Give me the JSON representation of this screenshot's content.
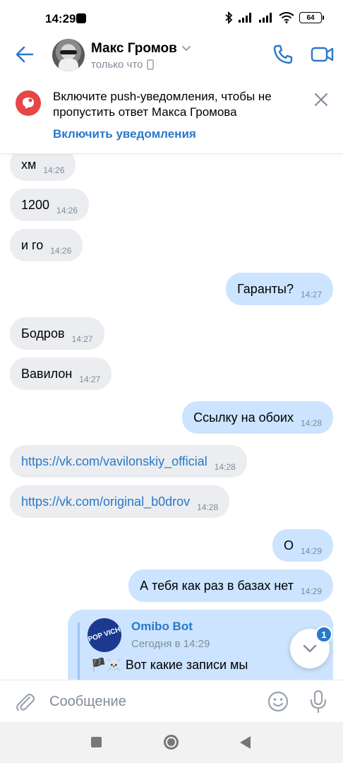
{
  "status_bar": {
    "time": "14:29",
    "battery": "64",
    "icons": [
      "notification-icon",
      "bluetooth-icon",
      "signal-icon",
      "signal-icon",
      "wifi-icon",
      "battery-icon"
    ]
  },
  "header": {
    "name": "Макс Громов",
    "status": "только что"
  },
  "banner": {
    "text": "Включите push-уведомления, чтобы не пропустить ответ Макса Громова",
    "link": "Включить уведомления"
  },
  "messages": [
    {
      "dir": "in",
      "text": "хм",
      "time": "14:26"
    },
    {
      "dir": "in",
      "text": "1200",
      "time": "14:26"
    },
    {
      "dir": "in",
      "text": "и го",
      "time": "14:26"
    },
    {
      "dir": "out",
      "text": "Гаранты?",
      "time": "14:27"
    },
    {
      "dir": "in",
      "text": "Бодров",
      "time": "14:27"
    },
    {
      "dir": "in",
      "text": "Вавилон",
      "time": "14:27"
    },
    {
      "dir": "out",
      "text": "Ссылку на обоих",
      "time": "14:28"
    },
    {
      "dir": "in",
      "text": "https://vk.com/vavilonskiy_official",
      "time": "14:28",
      "link": true
    },
    {
      "dir": "in",
      "text": "https://vk.com/original_b0drov",
      "time": "14:28",
      "link": true
    },
    {
      "dir": "out",
      "text": "О",
      "time": "14:29"
    },
    {
      "dir": "out",
      "text": "А тебя как раз в базах нет",
      "time": "14:29"
    }
  ],
  "repost": {
    "avatar_text": "POP VICH",
    "author": "Omibo Bot",
    "date": "Сегодня в 14:29",
    "text": "🏴☠️ Вот какие записи мы"
  },
  "scroll_badge": "1",
  "composer": {
    "placeholder": "Сообщение"
  },
  "colors": {
    "accent": "#2a78c8",
    "incoming_bubble": "#ebedf0",
    "outgoing_bubble": "#cce4ff",
    "banner_icon": "#e64646"
  }
}
